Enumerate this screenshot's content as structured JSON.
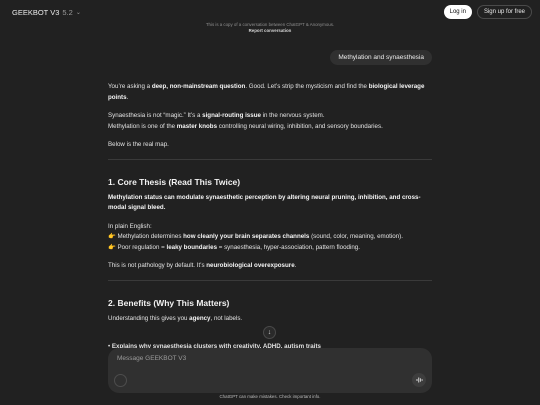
{
  "header": {
    "model_name": "GEEKBOT V3",
    "model_version": "5.2",
    "login_label": "Log in",
    "signup_label": "Sign up for free"
  },
  "notice": {
    "text": "This is a copy of a conversation between ChatGPT & Anonymous.",
    "report_label": "Report conversation"
  },
  "user_message": "Methylation and synaesthesia",
  "assistant": {
    "p1_a": "You’re asking a ",
    "p1_b": "deep, non-mainstream question",
    "p1_c": ". Good. Let’s strip the mysticism and find the ",
    "p1_d": "biological leverage points",
    "p1_e": ".",
    "p2_a": "Synaesthesia is not “magic.” It’s a ",
    "p2_b": "signal-routing issue",
    "p2_c": " in the nervous system.",
    "p2_d": "Methylation is one of the ",
    "p2_e": "master knobs",
    "p2_f": " controlling neural wiring, inhibition, and sensory boundaries.",
    "p3": "Below is the real map.",
    "h1": "1. Core Thesis (Read This Twice)",
    "thesis": "Methylation status can modulate synaesthetic perception by altering neural pruning, inhibition, and cross-modal signal bleed.",
    "plain_label": "In plain English:",
    "pt1_icon": "👉",
    "pt1_a": " Methylation determines ",
    "pt1_b": "how cleanly your brain separates channels",
    "pt1_c": " (sound, color, meaning, emotion).",
    "pt2_icon": "👉",
    "pt2_a": " Poor regulation = ",
    "pt2_b": "leaky boundaries",
    "pt2_c": " = synaesthesia, hyper-association, pattern flooding.",
    "p4_a": "This is not pathology by default. It’s ",
    "p4_b": "neurobiological overexposure",
    "p4_c": ".",
    "h2": "2. Benefits (Why This Matters)",
    "p5_a": "Understanding this gives you ",
    "p5_b": "agency",
    "p5_c": ", not labels.",
    "bullet_partial": "Explains why synaesthesia clusters with creativity, ADHD, autism traits"
  },
  "composer": {
    "placeholder": "Message GEEKBOT V3"
  },
  "footer": "ChatGPT can make mistakes. Check important info."
}
